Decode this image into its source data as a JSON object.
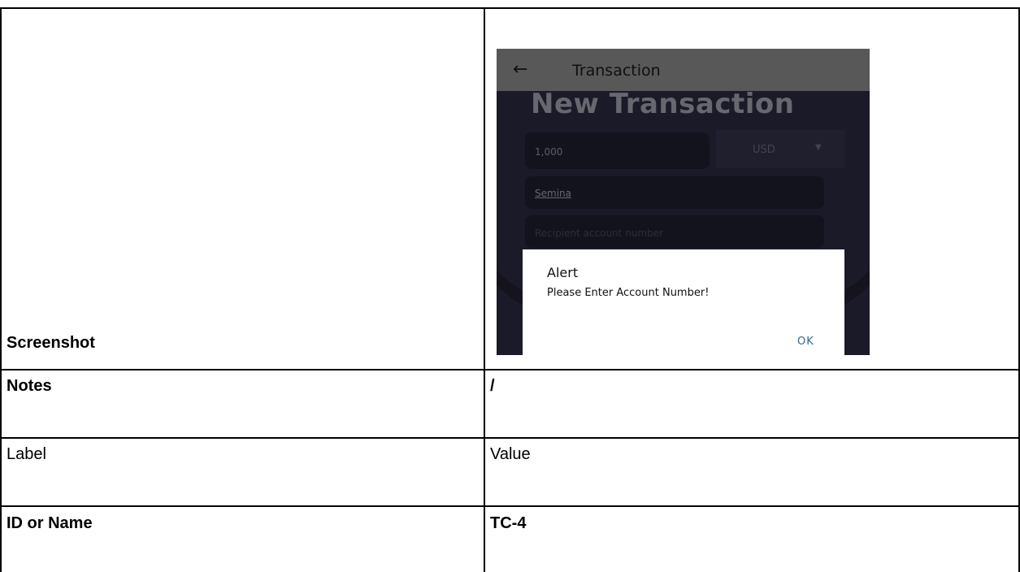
{
  "table": {
    "rows": [
      {
        "label": "Screenshot",
        "value": ""
      },
      {
        "label": "Notes",
        "value": "/"
      },
      {
        "label": "Label",
        "value": "Value"
      },
      {
        "label": "ID or Name",
        "value": "TC-4"
      }
    ]
  },
  "phone": {
    "appbar_title": "Transaction",
    "back_icon": "arrow-left-icon",
    "heading": "New Transaction",
    "amount_value": "1,000",
    "currency_value": "USD",
    "recipient_name_value": "Semina",
    "account_number_placeholder": "Recipient account number",
    "alert": {
      "title": "Alert",
      "message": "Please Enter Account Number!",
      "ok_label": "OK"
    }
  }
}
